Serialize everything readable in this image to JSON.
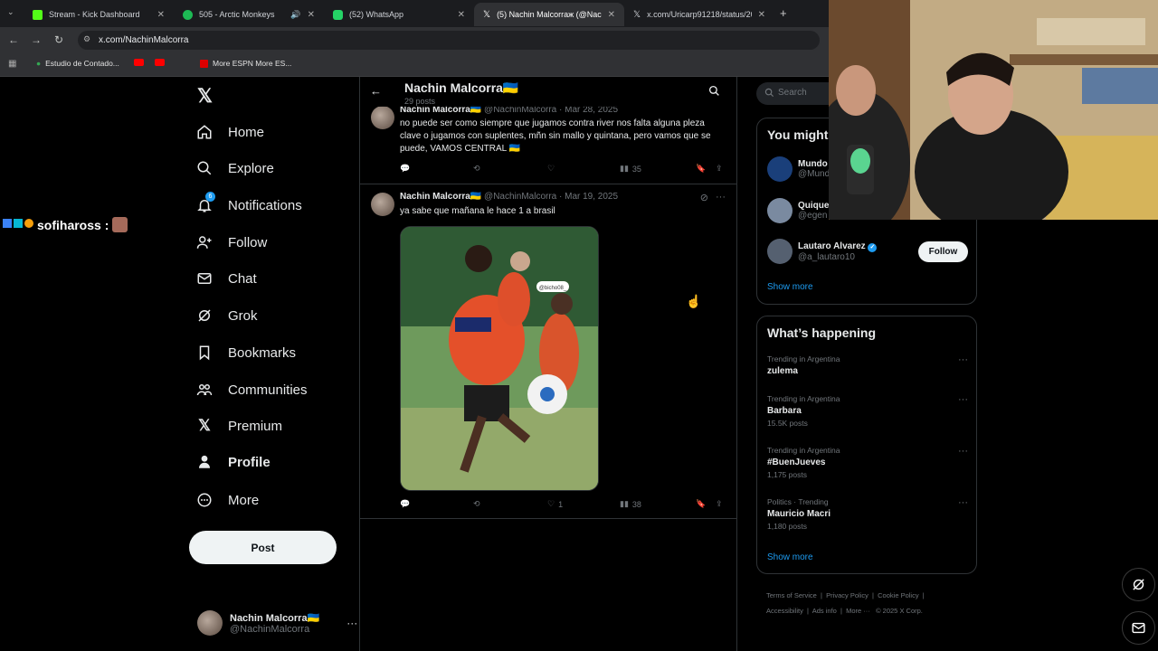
{
  "browser": {
    "tabs": [
      {
        "label": "Stream - Kick Dashboard",
        "color": "#53fc18"
      },
      {
        "label": "505 - Arctic Monkeys",
        "color": "#1db954"
      },
      {
        "label": "(52) WhatsApp",
        "color": "#25d366"
      },
      {
        "label": "(5) Nachin Malcorraж (@Nach",
        "color": "#ffffff"
      },
      {
        "label": "x.com/Uricarp91218/status/200",
        "color": "#ffffff"
      }
    ],
    "url": "x.com/NachinMalcorra",
    "bookmarks": [
      {
        "label": "Estudio de Contado..."
      },
      {
        "label": "More ESPN More ES..."
      }
    ]
  },
  "sidebar": {
    "items": [
      {
        "label": "Home",
        "icon": "home-icon"
      },
      {
        "label": "Explore",
        "icon": "search-icon"
      },
      {
        "label": "Notifications",
        "icon": "bell-icon",
        "badge": "6"
      },
      {
        "label": "Follow",
        "icon": "follow-icon"
      },
      {
        "label": "Chat",
        "icon": "mail-icon"
      },
      {
        "label": "Grok",
        "icon": "grok-icon"
      },
      {
        "label": "Bookmarks",
        "icon": "bookmark-icon"
      },
      {
        "label": "Communities",
        "icon": "communities-icon"
      },
      {
        "label": "Premium",
        "icon": "x-icon"
      },
      {
        "label": "Profile",
        "icon": "profile-icon"
      },
      {
        "label": "More",
        "icon": "more-icon"
      }
    ],
    "post_label": "Post",
    "account": {
      "name": "Nachin Malcorra🇺🇦",
      "handle": "@NachinMalcorra"
    }
  },
  "timeline": {
    "title": "Nachin Malcorra🇺🇦",
    "subtitle": "29 posts",
    "tweets": [
      {
        "name": "Nachin Malcorra🇺🇦",
        "handle": "@NachinMalcorra",
        "date": "· Mar 28, 2025",
        "text": "no puede ser como siempre que jugamos contra river nos falta alguna pleza clave o jugamos con suplentes, mñn sin mallo y quintana, pero vamos que se puede, VAMOS CENTRAL 🇺🇦",
        "replies": "",
        "retweets": "",
        "likes": "",
        "views": "35"
      },
      {
        "name": "Nachin Malcorra🇺🇦",
        "handle": "@NachinMalcorra",
        "date": "· Mar 19, 2025",
        "text": "ya sabe que mañana le hace 1 a brasil",
        "image_watermark": "@bicho08_",
        "replies": "",
        "retweets": "",
        "likes": "1",
        "views": "38"
      }
    ]
  },
  "right": {
    "search_placeholder": "Search",
    "who_title": "You might",
    "who": [
      {
        "name": "Mundo",
        "handle": "@Mund"
      },
      {
        "name": "Quique",
        "handle": "@egen"
      },
      {
        "name": "Lautaro Alvarez",
        "handle": "@a_lautaro10",
        "verified": true
      }
    ],
    "follow_label": "Follow",
    "show_more": "Show more",
    "trends_title": "What’s happening",
    "trends": [
      {
        "context": "Trending in Argentina",
        "name": "zulema",
        "count": ""
      },
      {
        "context": "Trending in Argentina",
        "name": "Barbara",
        "count": "15.5K posts"
      },
      {
        "context": "Trending in Argentina",
        "name": "#BuenJueves",
        "count": "1,175 posts"
      },
      {
        "context": "Politics · Trending",
        "name": "Mauricio Macri",
        "count": "1,180 posts"
      }
    ],
    "show_more_2": "Show more",
    "footer": [
      "Terms of Service",
      "Privacy Policy",
      "Cookie Policy",
      "Accessibility",
      "Ads info",
      "More ···",
      "© 2025 X Corp."
    ]
  },
  "overlay": {
    "username": "sofihaross :"
  },
  "colors": {
    "accent": "#1d9bf0",
    "background": "#000000"
  }
}
